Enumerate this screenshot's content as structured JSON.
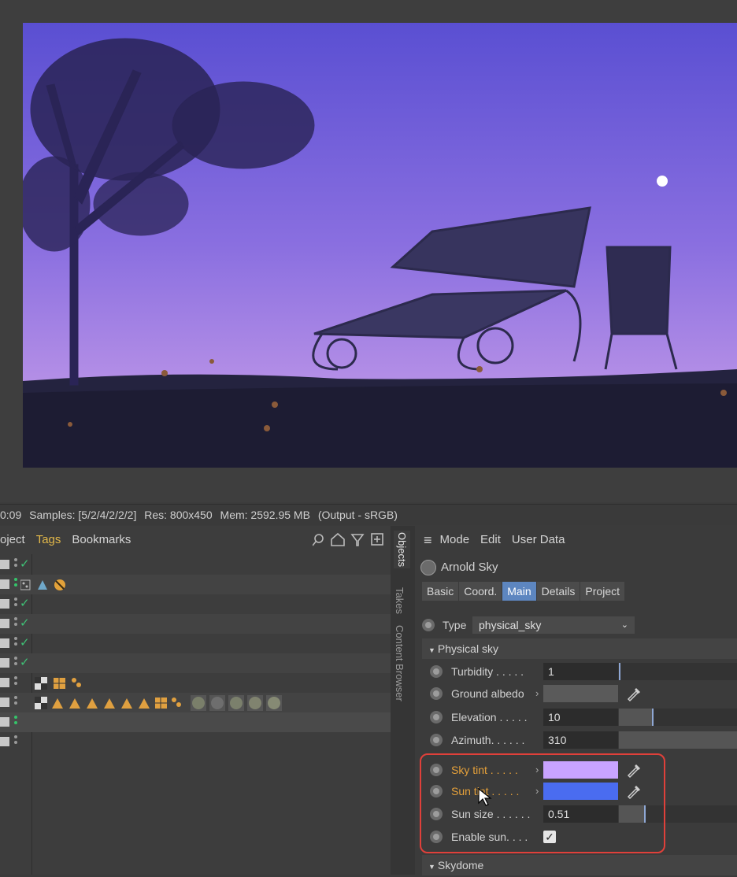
{
  "status": {
    "time": "0:09",
    "samples": "Samples: [5/2/4/2/2/2]",
    "res": "Res: 800x450",
    "mem": "Mem: 2592.95 MB",
    "output": "(Output - sRGB)"
  },
  "object_manager": {
    "menu": [
      "oject",
      "Tags",
      "Bookmarks"
    ],
    "side_tabs": [
      "Objects",
      "Takes",
      "Content Browser"
    ]
  },
  "attributes": {
    "menu": [
      "Mode",
      "Edit",
      "User Data"
    ],
    "title": "Arnold Sky",
    "tabs": [
      "Basic",
      "Coord.",
      "Main",
      "Details",
      "Project"
    ],
    "active_tab": "Main",
    "type_label": "Type",
    "type_value": "physical_sky",
    "group_physical": "Physical sky",
    "turbidity_label": "Turbidity . . . . .",
    "turbidity_value": "1",
    "ground_albedo_label": "Ground albedo",
    "elevation_label": "Elevation . . . . .",
    "elevation_value": "10",
    "azimuth_label": "Azimuth. . . . . .",
    "azimuth_value": "310",
    "sky_tint_label": "Sky tint . . . . .",
    "sky_tint_color": "#c9a3ff",
    "sun_tint_label": "Sun tint . . . . .",
    "sun_tint_color": "#4a6cf0",
    "sun_size_label": "Sun size . . . . . .",
    "sun_size_value": "0.51",
    "enable_sun_label": "Enable sun. . . .",
    "enable_sun_checked": true,
    "group_skydome": "Skydome"
  },
  "colors": {
    "accent_tab": "#5d86c0",
    "highlight": "#e0403a",
    "orange_label": "#e6a13a"
  }
}
